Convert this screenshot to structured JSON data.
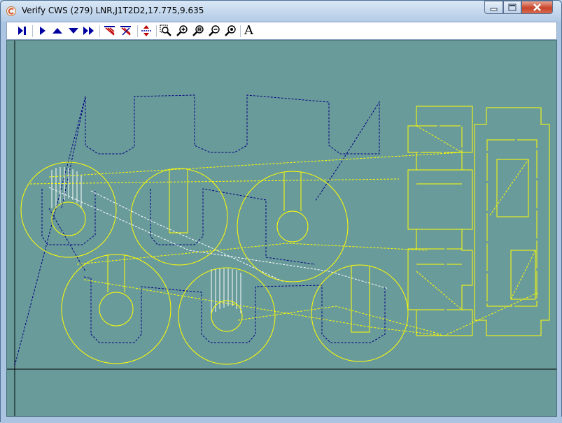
{
  "window": {
    "title": "Verify CWS (279) LNR,J1T2D2,17.775,9.635"
  },
  "caption_buttons": [
    {
      "name": "minimize-icon"
    },
    {
      "name": "maximize-icon"
    },
    {
      "name": "close-icon"
    }
  ],
  "toolbar": {
    "items": [
      {
        "name": "step-to-end-icon"
      },
      {
        "name": "play-icon"
      },
      {
        "name": "arrow-up-icon"
      },
      {
        "name": "arrow-down-icon"
      },
      {
        "name": "fast-forward-icon"
      },
      {
        "name": "show-path-icon"
      },
      {
        "name": "hide-path-icon"
      },
      {
        "name": "center-view-icon"
      },
      {
        "name": "zoom-window-icon"
      },
      {
        "name": "zoom-in-icon"
      },
      {
        "name": "zoom-fit-icon"
      },
      {
        "name": "zoom-out-icon"
      },
      {
        "name": "zoom-actual-icon"
      }
    ],
    "text_tool": "A"
  },
  "colors": {
    "canvas_background": "#6a9b9b",
    "part_outline": "#ffff00",
    "rapid_path": "#000080",
    "cut_path": "#ffffff",
    "axis": "#000000"
  }
}
